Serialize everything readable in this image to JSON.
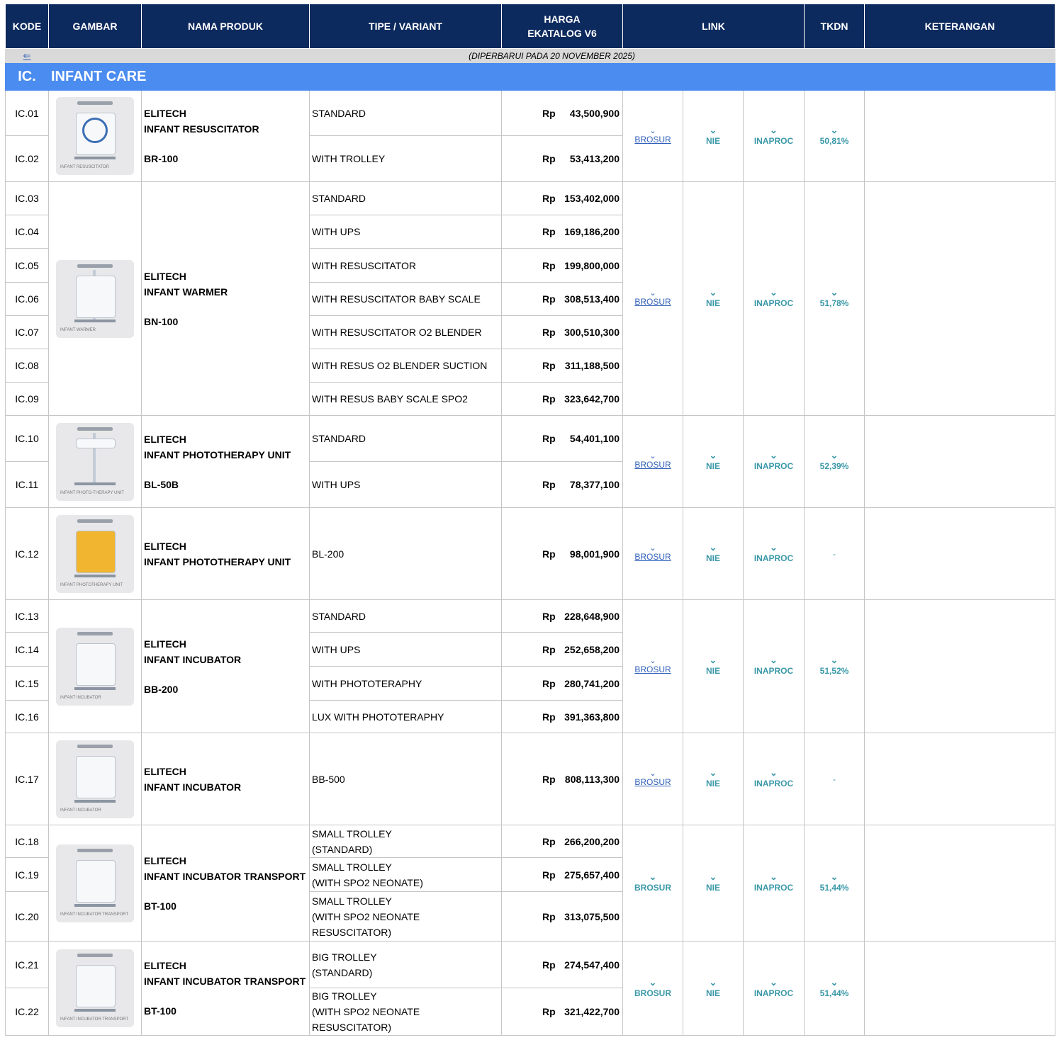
{
  "header": {
    "kode": "KODE",
    "gambar": "GAMBAR",
    "nama_produk": "NAMA PRODUK",
    "tipe": "TIPE / VARIANT",
    "harga_line1": "HARGA",
    "harga_line2": "EKATALOG V6",
    "link": "LINK",
    "tkdn": "TKDN",
    "keterangan": "KETERANGAN"
  },
  "back_arrow": "⇐",
  "updated_note": "(DIPERBARUI PADA 20 NOVEMBER 2025)",
  "section": {
    "code": "IC.",
    "title": "INFANT CARE"
  },
  "currency": "Rp",
  "links": {
    "brosur": "BROSUR",
    "nie": "NIE",
    "inaproc": "INAPROC",
    "chevron": "⌄"
  },
  "groups": [
    {
      "brand": "ELITECH",
      "product": "INFANT RESUSCITATOR",
      "type": "BR-100",
      "image_caption": "INFANT RESUSCITATOR",
      "tkdn": "50,81%",
      "brosur_style": "blue",
      "rows": [
        {
          "code": "IC.01",
          "variant": "STANDARD",
          "price": "43,500,900"
        },
        {
          "code": "IC.02",
          "variant": "WITH TROLLEY",
          "price": "53,413,200"
        }
      ]
    },
    {
      "brand": "ELITECH",
      "product": "INFANT WARMER",
      "type": "BN-100",
      "image_caption": "INFANT WARMER",
      "tkdn": "51,78%",
      "brosur_style": "blue",
      "rows": [
        {
          "code": "IC.03",
          "variant": "STANDARD",
          "price": "153,402,000"
        },
        {
          "code": "IC.04",
          "variant": "WITH UPS",
          "price": "169,186,200"
        },
        {
          "code": "IC.05",
          "variant": "WITH RESUSCITATOR",
          "price": "199,800,000"
        },
        {
          "code": "IC.06",
          "variant": "WITH RESUSCITATOR BABY SCALE",
          "price": "308,513,400"
        },
        {
          "code": "IC.07",
          "variant": "WITH RESUSCITATOR O2 BLENDER",
          "price": "300,510,300"
        },
        {
          "code": "IC.08",
          "variant": "WITH RESUS O2 BLENDER SUCTION",
          "price": "311,188,500"
        },
        {
          "code": "IC.09",
          "variant": "WITH RESUS BABY SCALE SPO2",
          "price": "323,642,700"
        }
      ]
    },
    {
      "brand": "ELITECH",
      "product": "INFANT PHOTOTHERAPY UNIT",
      "type": "BL-50B",
      "image_caption": "INFANT PHOTO-THERAPY UNIT",
      "tkdn": "52,39%",
      "brosur_style": "blue",
      "rows": [
        {
          "code": "IC.10",
          "variant": "STANDARD",
          "price": "54,401,100"
        },
        {
          "code": "IC.11",
          "variant": "WITH UPS",
          "price": "78,377,100"
        }
      ]
    },
    {
      "brand": "ELITECH",
      "product": "INFANT PHOTOTHERAPY UNIT",
      "type": "",
      "image_caption": "INFANT PHOTOTHERAPY UNIT",
      "tkdn": "-",
      "brosur_style": "blue",
      "rows": [
        {
          "code": "IC.12",
          "variant": "BL-200",
          "price": "98,001,900"
        }
      ]
    },
    {
      "brand": "ELITECH",
      "product": "INFANT INCUBATOR",
      "type": "BB-200",
      "image_caption": "INFANT INCUBATOR",
      "tkdn": "51,52%",
      "brosur_style": "blue",
      "rows": [
        {
          "code": "IC.13",
          "variant": "STANDARD",
          "price": "228,648,900"
        },
        {
          "code": "IC.14",
          "variant": "WITH UPS",
          "price": "252,658,200"
        },
        {
          "code": "IC.15",
          "variant": "WITH PHOTOTERAPHY",
          "price": "280,741,200"
        },
        {
          "code": "IC.16",
          "variant": "LUX WITH PHOTOTERAPHY",
          "price": "391,363,800"
        }
      ]
    },
    {
      "brand": "ELITECH",
      "product": "INFANT INCUBATOR",
      "type": "",
      "image_caption": "INFANT INCUBATOR",
      "tkdn": "-",
      "brosur_style": "blue",
      "rows": [
        {
          "code": "IC.17",
          "variant": "BB-500",
          "price": "808,113,300"
        }
      ]
    },
    {
      "brand": "ELITECH",
      "product": "INFANT INCUBATOR TRANSPORT",
      "type": "BT-100",
      "image_caption": "INFANT INCUBATOR TRANSPORT",
      "tkdn": "51,44%",
      "brosur_style": "teal",
      "rows": [
        {
          "code": "IC.18",
          "variant_l1": "SMALL TROLLEY",
          "variant_l2": "(STANDARD)",
          "variant_l3": "",
          "price": "266,200,200"
        },
        {
          "code": "IC.19",
          "variant_l1": "SMALL TROLLEY",
          "variant_l2": "(WITH SPO2 NEONATE)",
          "variant_l3": "",
          "price": "275,657,400"
        },
        {
          "code": "IC.20",
          "variant_l1": "SMALL TROLLEY",
          "variant_l2": "(WITH SPO2 NEONATE",
          "variant_l3": "RESUSCITATOR)",
          "price": "313,075,500"
        }
      ]
    },
    {
      "brand": "ELITECH",
      "product": "INFANT INCUBATOR TRANSPORT",
      "type": "BT-100",
      "image_caption": "INFANT INCUBATOR TRANSPORT",
      "tkdn": "51,44%",
      "brosur_style": "teal",
      "rows": [
        {
          "code": "IC.21",
          "variant_l1": "BIG TROLLEY",
          "variant_l2": "(STANDARD)",
          "variant_l3": "",
          "price": "274,547,400"
        },
        {
          "code": "IC.22",
          "variant_l1": "BIG TROLLEY",
          "variant_l2": "(WITH SPO2 NEONATE",
          "variant_l3": "RESUSCITATOR)",
          "price": "321,422,700"
        }
      ]
    }
  ]
}
